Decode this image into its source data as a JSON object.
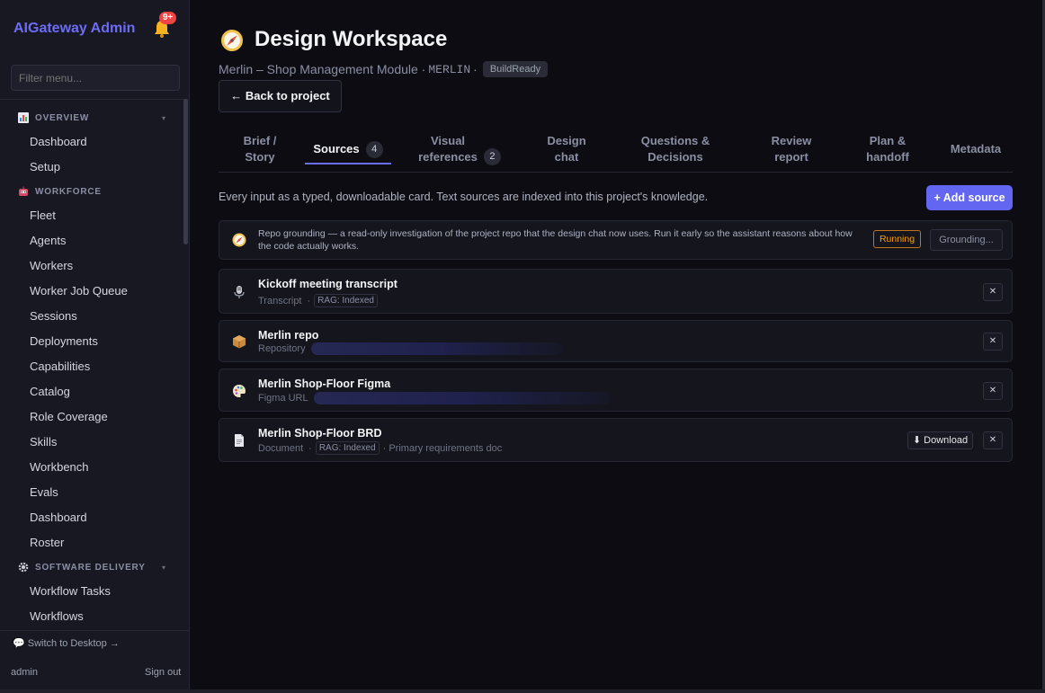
{
  "sidebar": {
    "brand": "AIGateway Admin",
    "notifications_badge": "9+",
    "filter_placeholder": "Filter menu...",
    "sections": [
      {
        "label": "OVERVIEW",
        "icon": "chart-icon",
        "items": [
          "Dashboard",
          "Setup"
        ]
      },
      {
        "label": "WORKFORCE",
        "icon": "robot-icon",
        "items": [
          "Fleet",
          "Agents",
          "Workers",
          "Worker Job Queue",
          "Sessions",
          "Deployments",
          "Capabilities",
          "Catalog",
          "Role Coverage",
          "Skills",
          "Workbench",
          "Evals",
          "Dashboard",
          "Roster"
        ]
      },
      {
        "label": "SOFTWARE DELIVERY",
        "icon": "gear-icon",
        "items": [
          "Workflow Tasks",
          "Workflows"
        ]
      }
    ],
    "switch_label": "💬 Switch to Desktop →",
    "user": "admin",
    "signout": "Sign out"
  },
  "header": {
    "title": "Design Workspace",
    "project": "Merlin – Shop Management Module ·",
    "code": "MERLIN",
    "sep": "·",
    "status": "BuildReady",
    "back_label": "← Back to project"
  },
  "tabs": [
    {
      "l1": "Brief /",
      "l2": "Story",
      "count": null
    },
    {
      "l1": "Sources",
      "l2": "",
      "count": "4"
    },
    {
      "l1": "Visual",
      "l2": "references",
      "count": "2"
    },
    {
      "l1": "Design",
      "l2": "chat",
      "count": null
    },
    {
      "l1": "Questions &",
      "l2": "Decisions",
      "count": null
    },
    {
      "l1": "Review",
      "l2": "report",
      "count": null
    },
    {
      "l1": "Plan &",
      "l2": "handoff",
      "count": null
    },
    {
      "l1": "Metadata",
      "l2": "",
      "count": null
    }
  ],
  "sources": {
    "description": "Every input as a typed, downloadable card. Text sources are indexed into this project's knowledge.",
    "add_label": "+ Add source",
    "grounding": {
      "text": "Repo grounding — a read-only investigation of the project repo that the design chat now uses. Run it early so the assistant reasons about how the code actually works.",
      "status": "Running",
      "button": "Grounding..."
    },
    "cards": [
      {
        "title": "Kickoff meeting transcript",
        "type": "Transcript",
        "rag": "RAG: Indexed",
        "note": "",
        "icon": "microphone-icon"
      },
      {
        "title": "Merlin repo",
        "type": "Repository",
        "rag": "",
        "note": "",
        "icon": "package-icon"
      },
      {
        "title": "Merlin Shop-Floor Figma",
        "type": "Figma URL",
        "rag": "",
        "note": "",
        "icon": "palette-icon"
      },
      {
        "title": "Merlin Shop-Floor BRD",
        "type": "Document",
        "rag": "RAG: Indexed",
        "note": "· Primary requirements doc",
        "icon": "document-icon"
      }
    ],
    "download_label": "⬇ Download",
    "remove_label": "✕"
  }
}
